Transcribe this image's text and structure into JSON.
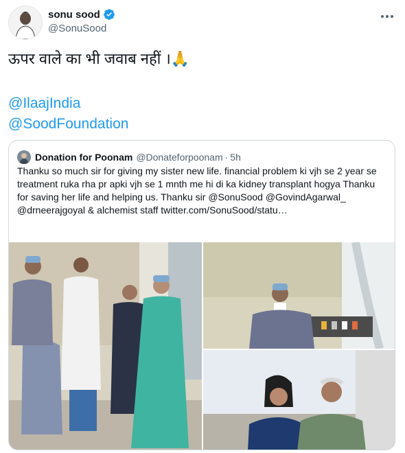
{
  "author": {
    "display_name": "sonu sood",
    "handle": "@SonuSood",
    "verified_icon": "verified-badge-icon",
    "avatar_icon": "avatar-photo"
  },
  "tweet": {
    "text": "ऊपर वाले का भी जवाब नहीं ।🙏",
    "mentions": [
      "@IlaajIndia",
      "@SoodFoundation"
    ]
  },
  "quoted_tweet": {
    "display_name": "Donation for Poonam",
    "handle": "@Donateforpoonam",
    "separator": "·",
    "time": "5h",
    "text": "Thanku so much sir for giving my sister new life. financial problem ki vjh se 2 year se treatment ruka rha pr apki vjh se 1 mnth me hi di ka kidney transplant hogya Thanku for saving her life and helping us. Thanku sir @SonuSood @GovindAgarwal_ @drneerajgoyal & alchemist staff twitter.com/SonuSood/statu…",
    "media": [
      "hospital-group-photo",
      "patient-in-hospital-bed-photo",
      "siblings-rooftop-photo"
    ]
  },
  "colors": {
    "link": "#1d9bf0",
    "verified": "#1d9bf0",
    "text": "#0f1419",
    "secondary": "#536471",
    "border": "#cfd9de"
  }
}
